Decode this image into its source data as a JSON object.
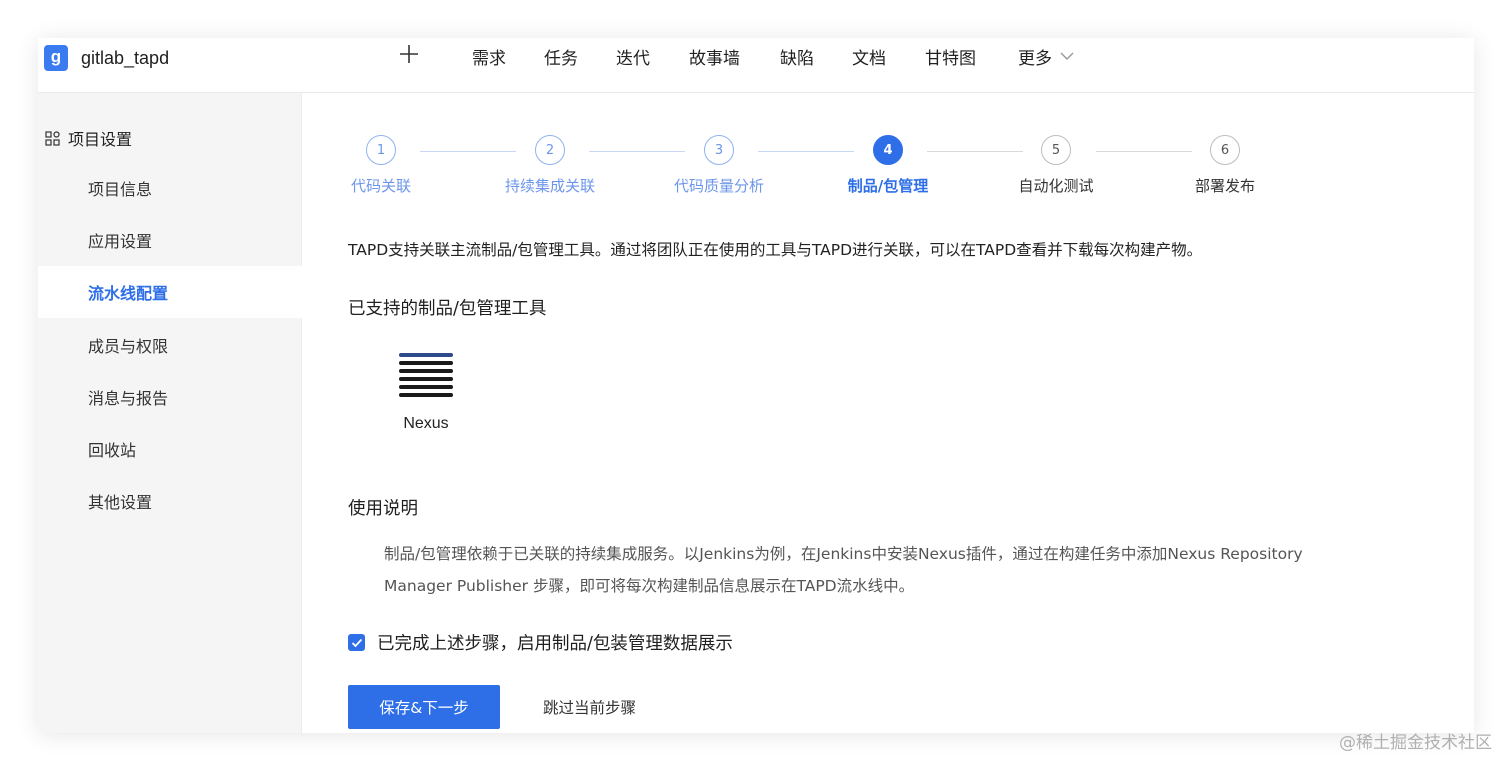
{
  "header": {
    "logo_letter": "g",
    "project_name": "gitlab_tapd",
    "plus_icon": "plus-icon",
    "nav": [
      "需求",
      "任务",
      "迭代",
      "故事墙",
      "缺陷",
      "文档",
      "甘特图"
    ],
    "more_label": "更多"
  },
  "sidebar": {
    "title": "项目设置",
    "items": [
      {
        "label": "项目信息",
        "active": false
      },
      {
        "label": "应用设置",
        "active": false
      },
      {
        "label": "流水线配置",
        "active": true
      },
      {
        "label": "成员与权限",
        "active": false
      },
      {
        "label": "消息与报告",
        "active": false
      },
      {
        "label": "回收站",
        "active": false
      },
      {
        "label": "其他设置",
        "active": false
      }
    ]
  },
  "steps": [
    {
      "num": "1",
      "label": "代码关联",
      "state": "done"
    },
    {
      "num": "2",
      "label": "持续集成关联",
      "state": "done"
    },
    {
      "num": "3",
      "label": "代码质量分析",
      "state": "done"
    },
    {
      "num": "4",
      "label": "制品/包管理",
      "state": "active"
    },
    {
      "num": "5",
      "label": "自动化测试",
      "state": "todo"
    },
    {
      "num": "6",
      "label": "部署发布",
      "state": "todo"
    }
  ],
  "main": {
    "description": "TAPD支持关联主流制品/包管理工具。通过将团队正在使用的工具与TAPD进行关联，可以在TAPD查看并下载每次构建产物。",
    "supported_title": "已支持的制品/包管理工具",
    "tool": {
      "name": "Nexus",
      "icon": "nexus-icon"
    },
    "usage_title": "使用说明",
    "usage_line1": "制品/包管理依赖于已关联的持续集成服务。以Jenkins为例，在Jenkins中安装Nexus插件，通过在构建任务中添加Nexus Repository",
    "usage_line2": "Manager Publisher 步骤，即可将每次构建制品信息展示在TAPD流水线中。",
    "checkbox_label": "已完成上述步骤，启用制品/包装管理数据展示",
    "checkbox_checked": true,
    "save_label": "保存&下一步",
    "skip_label": "跳过当前步骤"
  },
  "watermark": "@稀土掘金技术社区",
  "colors": {
    "accent": "#2e6fe8",
    "logo": "#3b7bf0",
    "step_done": "#6c96ea"
  }
}
